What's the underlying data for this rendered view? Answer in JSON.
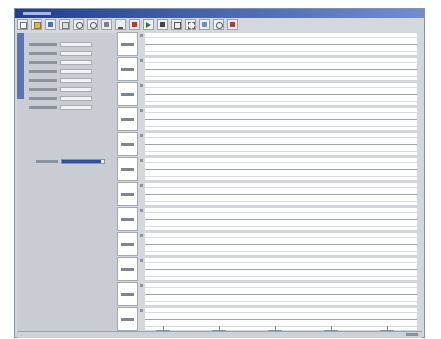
{
  "window": {
    "title": ""
  },
  "toolbar": {
    "buttons": [
      {
        "name": "toolbar-button-1",
        "icon": "new-icon",
        "label": ""
      },
      {
        "name": "toolbar-button-2",
        "icon": "open-icon",
        "label": ""
      },
      {
        "name": "toolbar-button-3",
        "icon": "save-icon",
        "label": ""
      },
      {
        "name": "toolbar-button-4",
        "icon": "print-icon",
        "label": ""
      },
      {
        "name": "toolbar-button-5",
        "icon": "zoom-in-icon",
        "label": ""
      },
      {
        "name": "toolbar-button-6",
        "icon": "zoom-out-icon",
        "label": ""
      },
      {
        "name": "toolbar-button-7",
        "icon": "pan-icon",
        "label": ""
      },
      {
        "name": "toolbar-button-8",
        "icon": "measure-icon",
        "label": ""
      },
      {
        "name": "toolbar-button-9",
        "icon": "marker-icon",
        "label": ""
      },
      {
        "name": "toolbar-button-10",
        "icon": "play-icon",
        "label": ""
      },
      {
        "name": "toolbar-button-11",
        "icon": "stop-icon",
        "label": ""
      },
      {
        "name": "toolbar-button-12",
        "icon": "settings-icon",
        "label": ""
      },
      {
        "name": "toolbar-button-13",
        "icon": "grid-icon",
        "label": ""
      },
      {
        "name": "toolbar-button-14",
        "icon": "export-icon",
        "label": ""
      },
      {
        "name": "toolbar-button-15",
        "icon": "help-icon",
        "label": ""
      },
      {
        "name": "toolbar-button-16",
        "icon": "close-icon",
        "label": ""
      }
    ]
  },
  "sidebar": {
    "tab_label": "",
    "parameters": [
      {
        "label": "",
        "value": ""
      },
      {
        "label": "",
        "value": ""
      },
      {
        "label": "",
        "value": ""
      },
      {
        "label": "",
        "value": ""
      },
      {
        "label": "",
        "value": ""
      },
      {
        "label": "",
        "value": ""
      },
      {
        "label": "",
        "value": ""
      },
      {
        "label": "",
        "value": ""
      }
    ],
    "setting": {
      "label": "",
      "level": 0.92
    }
  },
  "channels": [
    {
      "label": "",
      "scale": ""
    },
    {
      "label": "",
      "scale": ""
    },
    {
      "label": "",
      "scale": ""
    },
    {
      "label": "",
      "scale": ""
    },
    {
      "label": "",
      "scale": ""
    },
    {
      "label": "",
      "scale": ""
    },
    {
      "label": "",
      "scale": ""
    },
    {
      "label": "",
      "scale": ""
    },
    {
      "label": "",
      "scale": ""
    },
    {
      "label": "",
      "scale": ""
    },
    {
      "label": "",
      "scale": ""
    },
    {
      "label": "",
      "scale": ""
    }
  ],
  "x_axis": {
    "tick_labels": [
      "",
      "",
      "",
      "",
      ""
    ]
  },
  "status": {
    "right_text": ""
  },
  "colors": {
    "window_bg": "#d4d8dc",
    "panel_bg": "#c9cdd3",
    "trace_bg": "#ffffff",
    "accent": "#2a4fb1",
    "titlebar": "#1f3f8f"
  }
}
